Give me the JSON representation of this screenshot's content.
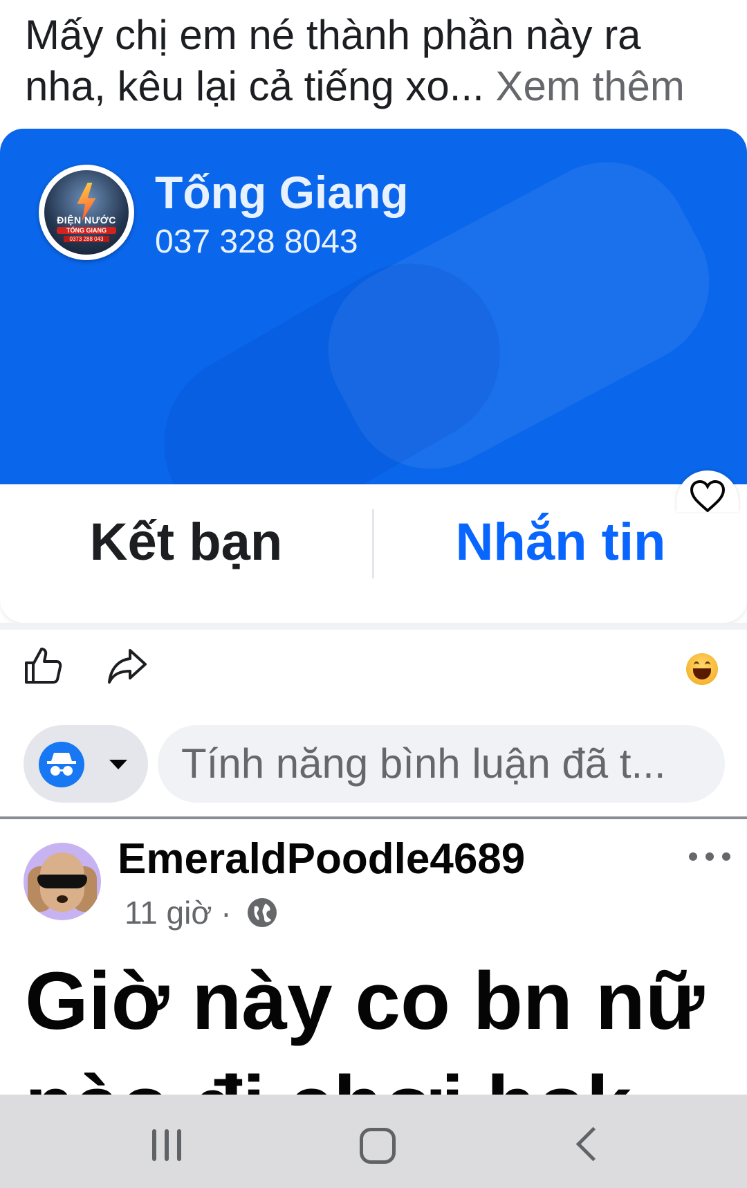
{
  "post_top": {
    "caption": "Mấy chị em né thành phần này ra nha, kêu lại cả tiếng xo...",
    "see_more": "Xem thêm"
  },
  "contact_card": {
    "name": "Tống Giang",
    "phone": "037 328 8043",
    "logo_text_line1": "ĐIỆN NƯỚC",
    "logo_text_line2": "TỐNG GIANG",
    "logo_text_line3": "0373 288 043",
    "add_friend_label": "Kết bạn",
    "message_label": "Nhắn tin",
    "bg_color": "#0a66ea",
    "message_color": "#0866ff"
  },
  "actions": {
    "like_icon": "thumbs-up-icon",
    "share_icon": "share-arrow-icon",
    "reaction_icon": "laughing-emoji-icon"
  },
  "comment_box": {
    "placeholder": "Tính năng bình luận đã t...",
    "identity_icon": "incognito-icon"
  },
  "next_post": {
    "author": "EmeraldPoodle4689",
    "time": "11 giờ ·",
    "privacy_icon": "globe-icon",
    "text_line1": "Giờ này co bn nữ",
    "text_line2": "nào đi chơi hok"
  },
  "navbar": {
    "recent_icon": "recent-apps-icon",
    "home_icon": "home-icon",
    "back_icon": "back-icon"
  }
}
